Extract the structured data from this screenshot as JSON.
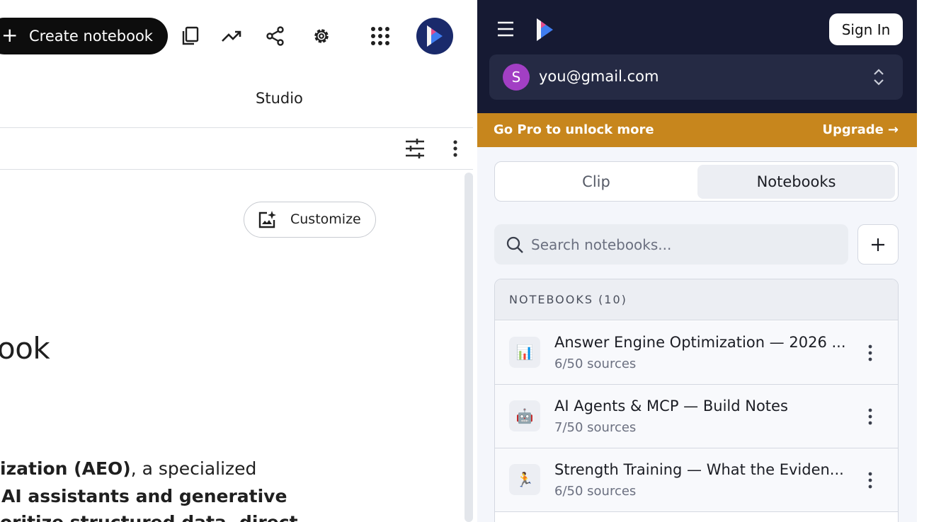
{
  "toolbar": {
    "create_plus": "+",
    "create_label": "Create notebook"
  },
  "studio": {
    "title": "Studio",
    "customize_label": "Customize"
  },
  "content": {
    "heading_fragment": "ook",
    "line1_bold": "ization (AEO)",
    "line1_rest": ", a specialized",
    "line2_bold": "AI assistants and generative",
    "line3_partial": "oritize structured data, direct"
  },
  "panel": {
    "signin_label": "Sign In",
    "account": {
      "initial": "S",
      "email": "you@gmail.com"
    },
    "promo": {
      "text": "Go Pro to unlock more",
      "action": "Upgrade",
      "arrow": "→"
    },
    "tabs": [
      {
        "label": "Clip",
        "active": false
      },
      {
        "label": "Notebooks",
        "active": true
      }
    ],
    "search": {
      "placeholder": "Search notebooks..."
    },
    "add_label": "+",
    "list_header": "NOTEBOOKS (10)",
    "notebooks": [
      {
        "emoji": "📊",
        "title": "Answer Engine Optimization — 2026 ...",
        "sources": "6/50 sources"
      },
      {
        "emoji": "🤖",
        "title": "AI Agents & MCP — Build Notes",
        "sources": "7/50 sources"
      },
      {
        "emoji": "🏃",
        "title": "Strength Training — What the Eviden...",
        "sources": "6/50 sources"
      }
    ]
  },
  "colors": {
    "panel_header": "#161a33",
    "account_bg": "#252a44",
    "promo_bg": "#c7861d",
    "avatar_bg": "#a23fc4",
    "create_btn_bg": "#0d0d0d"
  }
}
